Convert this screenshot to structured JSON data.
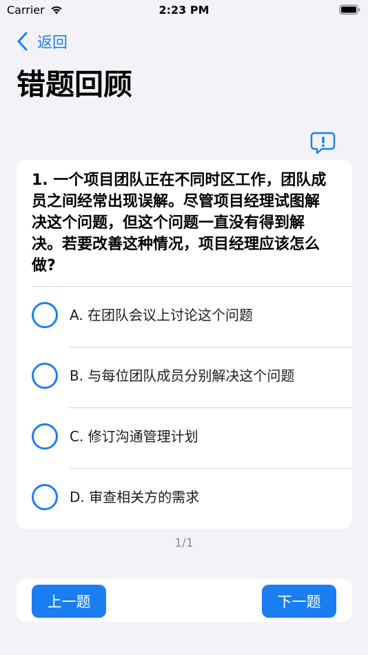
{
  "status_bar": {
    "carrier": "Carrier",
    "time": "2:23 PM"
  },
  "nav": {
    "back_label": "返回"
  },
  "page": {
    "title": "错题回顾"
  },
  "question": {
    "text": "1. 一个项目团队正在不同时区工作，团队成员之间经常出现误解。尽管项目经理试图解决这个问题，但这个问题一直没有得到解决。若要改善这种情况，项目经理应该怎么做?",
    "options": [
      {
        "label": "A. 在团队会议上讨论这个问题"
      },
      {
        "label": "B. 与每位团队成员分别解决这个问题"
      },
      {
        "label": "C. 修订沟通管理计划"
      },
      {
        "label": "D. 审查相关方的需求"
      }
    ]
  },
  "pagination": {
    "counter": "1/1"
  },
  "footer": {
    "prev_label": "上一题",
    "next_label": "下一题"
  },
  "colors": {
    "accent": "#1a7ef2",
    "background": "#f2f2f7",
    "card": "#ffffff",
    "separator": "#d1d1d6",
    "muted_text": "#8e8e93"
  },
  "icons": {
    "signal": "wifi-icon",
    "battery": "battery-icon",
    "back": "chevron-left-icon",
    "feedback": "exclamation-bubble-icon"
  }
}
